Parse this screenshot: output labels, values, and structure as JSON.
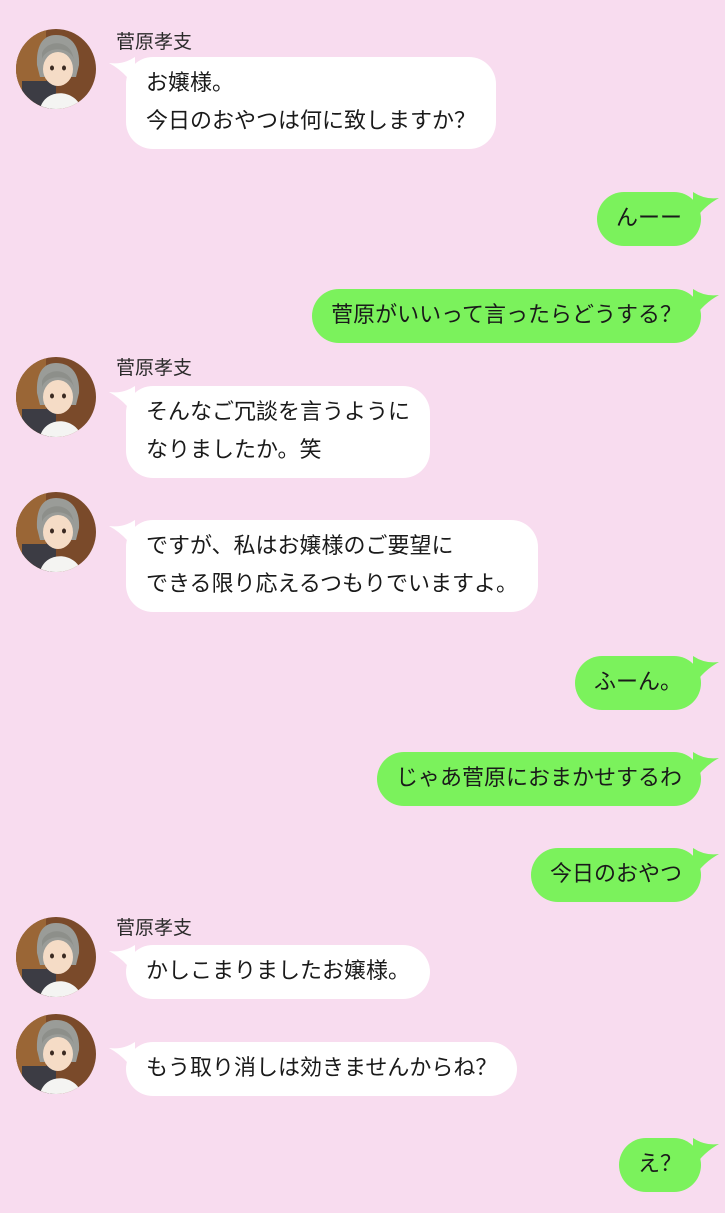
{
  "contact": {
    "name": "菅原孝支"
  },
  "colors": {
    "background": "#f8dcef",
    "incoming_bubble": "#ffffff",
    "outgoing_bubble": "#7bf25c"
  },
  "messages": [
    {
      "direction": "incoming",
      "show_name": true,
      "lines": [
        "お嬢様。",
        "今日のおやつは何に致しますか？"
      ]
    },
    {
      "direction": "outgoing",
      "lines": [
        "んーー"
      ]
    },
    {
      "direction": "outgoing",
      "lines": [
        "菅原がいいって言ったらどうする？"
      ]
    },
    {
      "direction": "incoming",
      "show_name": true,
      "lines": [
        "そんなご冗談を言うように",
        "なりましたか。笑"
      ]
    },
    {
      "direction": "incoming",
      "show_name": false,
      "lines": [
        "ですが、私はお嬢様のご要望に",
        "できる限り応えるつもりでいますよ。"
      ]
    },
    {
      "direction": "outgoing",
      "lines": [
        "ふーん。"
      ]
    },
    {
      "direction": "outgoing",
      "lines": [
        "じゃあ菅原におまかせするわ"
      ]
    },
    {
      "direction": "outgoing",
      "lines": [
        "今日のおやつ"
      ]
    },
    {
      "direction": "incoming",
      "show_name": true,
      "lines": [
        "かしこまりましたお嬢様。"
      ]
    },
    {
      "direction": "incoming",
      "show_name": false,
      "lines": [
        "もう取り消しは効きませんからね？"
      ]
    },
    {
      "direction": "outgoing",
      "lines": [
        "え？"
      ]
    }
  ]
}
